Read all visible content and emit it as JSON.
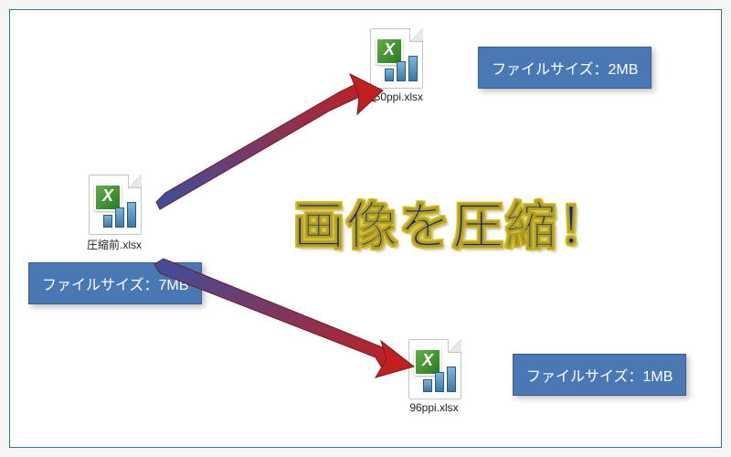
{
  "headline": "画像を圧縮！",
  "source_file": {
    "name": "圧縮前.xlsx",
    "size_label": "ファイルサイズ：7MB"
  },
  "result_files": [
    {
      "name": "150ppi.xlsx",
      "size_label": "ファイルサイズ：2MB"
    },
    {
      "name": "96ppi.xlsx",
      "size_label": "ファイルサイズ：1MB"
    }
  ],
  "colors": {
    "frame": "#2b7a8c",
    "badge_bg": "#4a78b5",
    "headline_fill": "#1a1f8a",
    "headline_outline": "#d6c030",
    "arrow_start": "#3a4fa0",
    "arrow_end": "#c02020"
  }
}
